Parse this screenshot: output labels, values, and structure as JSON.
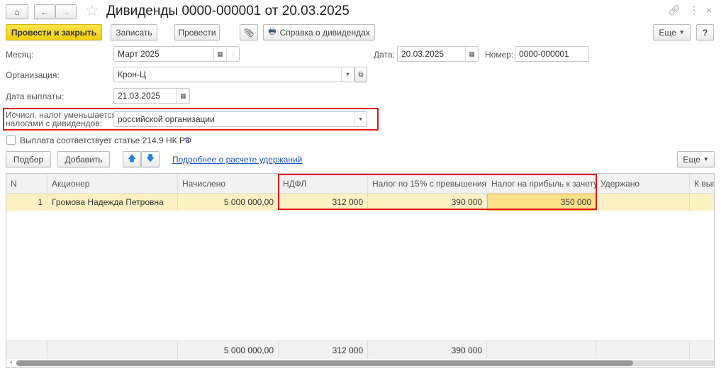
{
  "title": "Дивиденды 0000-000001 от 20.03.2025",
  "toolbar": {
    "post_close": "Провести и закрыть",
    "save": "Записать",
    "post": "Провести",
    "report": "Справка о дивидендах",
    "more": "Еще",
    "help": "?"
  },
  "form": {
    "month_label": "Месяц:",
    "month_value": "Март 2025",
    "date_label": "Дата:",
    "date_value": "20.03.2025",
    "number_label": "Номер:",
    "number_value": "0000-000001",
    "org_label": "Организация:",
    "org_value": "Крон-Ц",
    "paydate_label": "Дата выплаты:",
    "paydate_value": "21.03.2025",
    "reduce_label_1": "Исчисл. налог уменьшается",
    "reduce_label_2": "налогами с дивидендов:",
    "reduce_value": "российской организации",
    "checkbox_label": "Выплата соответствует статье 214.9 НК РФ",
    "checkbox_help": "?"
  },
  "table_toolbar": {
    "select": "Подбор",
    "add": "Добавить",
    "link": "Подробнее о расчете удержаний",
    "more": "Еще"
  },
  "table": {
    "columns": [
      "N",
      "Акционер",
      "Начислено",
      "НДФЛ",
      "Налог по 15% с превышения",
      "Налог на прибыль к зачету",
      "Удержано",
      "К вып"
    ],
    "rows": [
      [
        "1",
        "Громова Надежда Петровна",
        "5 000 000,00",
        "312 000",
        "390 000",
        "350 000",
        "",
        ""
      ]
    ],
    "totals": [
      "",
      "",
      "5 000 000,00",
      "312 000",
      "390 000",
      "",
      "",
      ""
    ]
  },
  "colors": {
    "accent": "#f2cf10",
    "highlight": "#e3121a",
    "row": "#fdf1c3"
  }
}
